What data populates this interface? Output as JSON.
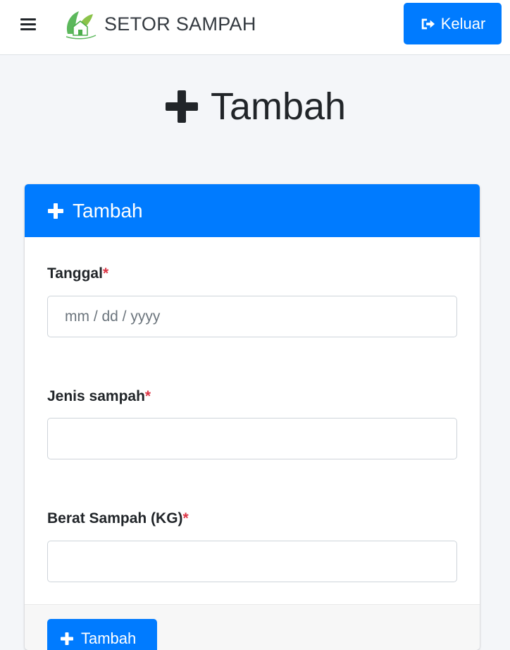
{
  "navbar": {
    "brand_text": "SETOR SAMPAH",
    "logout_label": "Keluar",
    "brand_color": "#5cb85c"
  },
  "page": {
    "heading": "Tambah"
  },
  "card": {
    "header_title": "Tambah",
    "header_color": "#007bff",
    "fields": [
      {
        "label": "Tanggal",
        "required_mark": "*",
        "placeholder": "mm / dd / yyyy",
        "value": ""
      },
      {
        "label": "Jenis sampah",
        "required_mark": "*",
        "placeholder": "",
        "value": ""
      },
      {
        "label": "Berat Sampah (KG)",
        "required_mark": "*",
        "placeholder": "",
        "value": ""
      }
    ],
    "submit_label": "Tambah"
  },
  "icons": {
    "menu": "hamburger-icon",
    "logo": "leaf-house-logo-icon",
    "logout": "sign-out-icon",
    "plus": "plus-icon"
  }
}
